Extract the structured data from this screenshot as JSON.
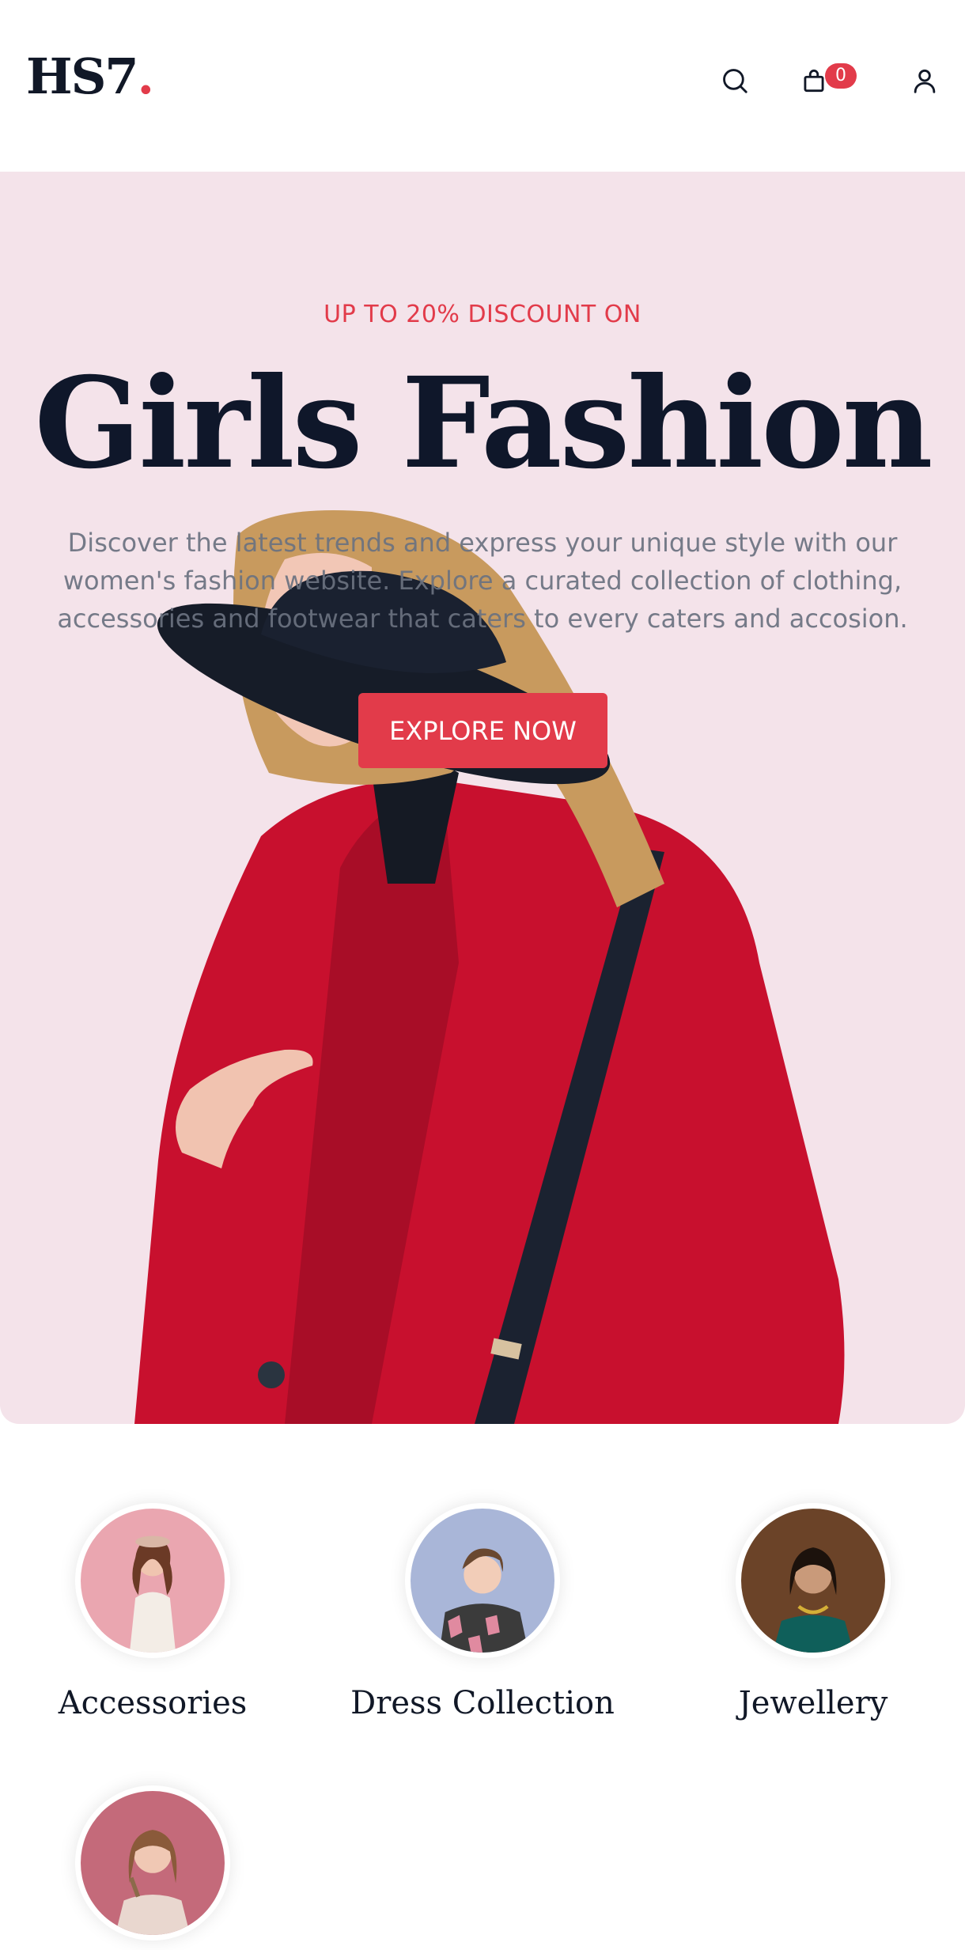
{
  "header": {
    "logo_text": "HS7",
    "logo_dot": ".",
    "cart_count": "0",
    "icons": [
      "search-icon",
      "shopping-bag-icon",
      "user-icon"
    ]
  },
  "hero": {
    "subheading": "UP TO 20% DISCOUNT ON",
    "title": "Girls Fashion",
    "description": "Discover the latest trends and express your unique style with our women's fashion website. Explore a curated collection of clothing, accessories and footwear that caters to every caters and accosion.",
    "cta_label": "EXPLORE NOW"
  },
  "categories": [
    {
      "label": "Accessories"
    },
    {
      "label": "Dress Collection"
    },
    {
      "label": "Jewellery"
    },
    {
      "label": ""
    }
  ],
  "colors": {
    "accent": "#e23b4a",
    "hero_bg": "#f4e3ea",
    "text_dark": "#0f172a",
    "text_muted": "#6b7280"
  }
}
